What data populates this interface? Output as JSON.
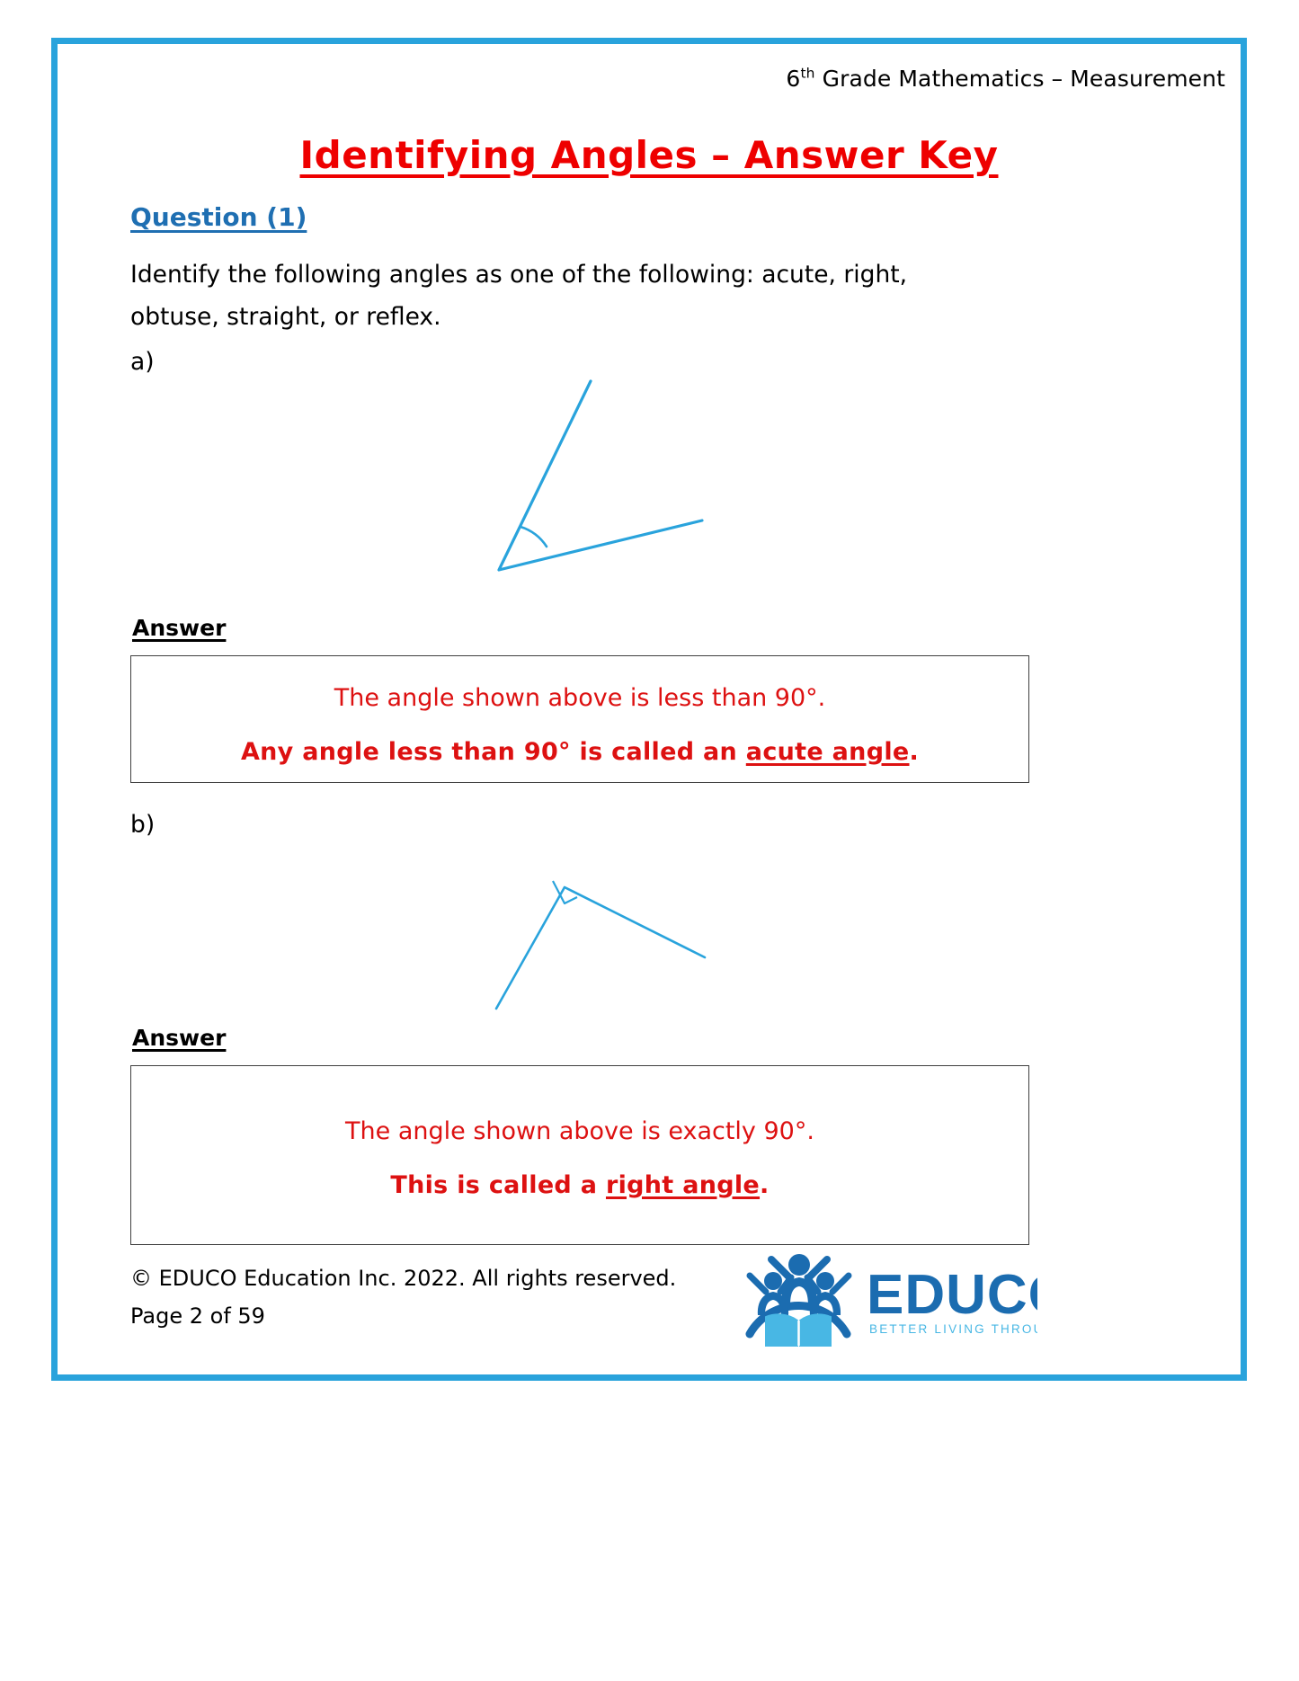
{
  "document": {
    "header_prefix": "6",
    "header_sup": "th",
    "header_rest": " Grade Mathematics – Measurement",
    "title": "Identifying Angles – Answer Key",
    "accent_border_color": "#29A3DC",
    "title_color": "#EE0000",
    "heading_color": "#1F6FB2",
    "answer_text_color": "#DD1111"
  },
  "question": {
    "heading": "Question (1)",
    "prompt": "Identify the following angles as one of the following: acute, right, obtuse, straight, or reflex."
  },
  "parts": [
    {
      "label": "a)",
      "answer_label": "Answer",
      "figure_name": "acute-angle-figure",
      "answer_line_1": "The angle shown above is less than 90°.",
      "answer_line_2_pre": "Any angle less than 90° is called an ",
      "answer_line_2_underlined": "acute angle",
      "answer_line_2_post": "."
    },
    {
      "label": "b)",
      "answer_label": "Answer",
      "figure_name": "right-angle-figure",
      "answer_line_1": "The angle shown above is exactly 90°.",
      "answer_line_2_pre": "This is called a ",
      "answer_line_2_underlined": "right angle",
      "answer_line_2_post": "."
    }
  ],
  "footer": {
    "copyright": "© EDUCO Education Inc. 2022. All rights reserved.",
    "page": "Page 2 of 59"
  },
  "logo": {
    "wordmark": "EDUCO",
    "tagline": "BETTER LIVING THROUGH LEARNING",
    "mark_color_dark": "#1B6CB0",
    "mark_color_light": "#48B7E4"
  }
}
